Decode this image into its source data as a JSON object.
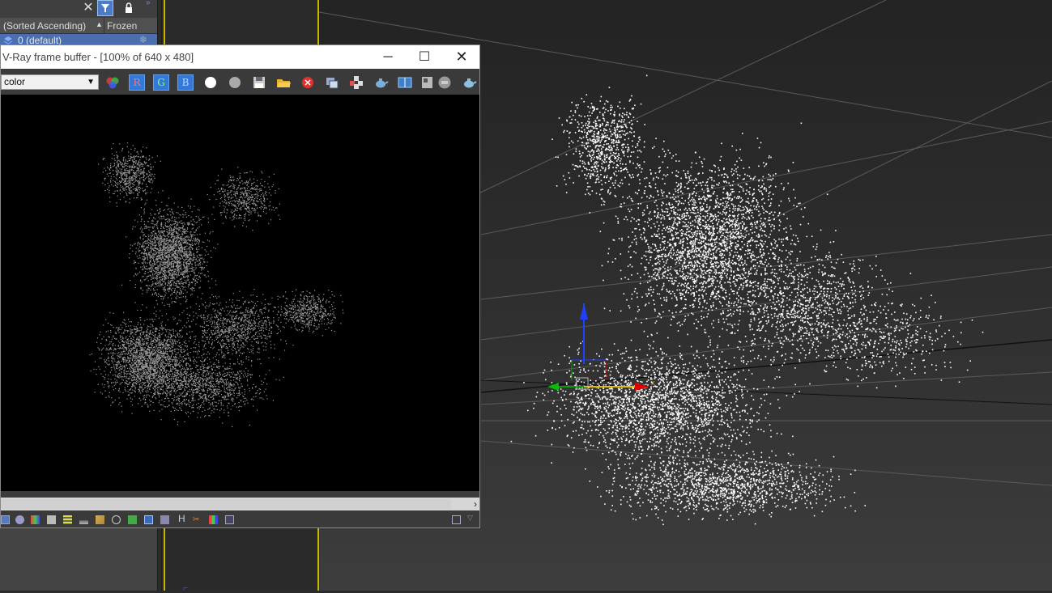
{
  "layer_explorer": {
    "sort_column_label": "(Sorted Ascending)",
    "frozen_column_label": "Frozen",
    "layer_name": "0 (default)"
  },
  "vfb": {
    "title": "V-Ray frame buffer - [100% of 640 x 480]",
    "channel": "color",
    "r_label": "R",
    "g_label": "G",
    "b_label": "B",
    "bottom_h_label": "H"
  },
  "viewport": {
    "gizmo_x_label": "x"
  },
  "colors": {
    "title_bar": "#ffffff",
    "rgb_button": "#3478d8",
    "selection": "#4c6eae",
    "viewport_border": "#c9b400",
    "gizmo_x": "#d00000",
    "gizmo_y": "#00a000",
    "gizmo_z": "#0000e0"
  }
}
